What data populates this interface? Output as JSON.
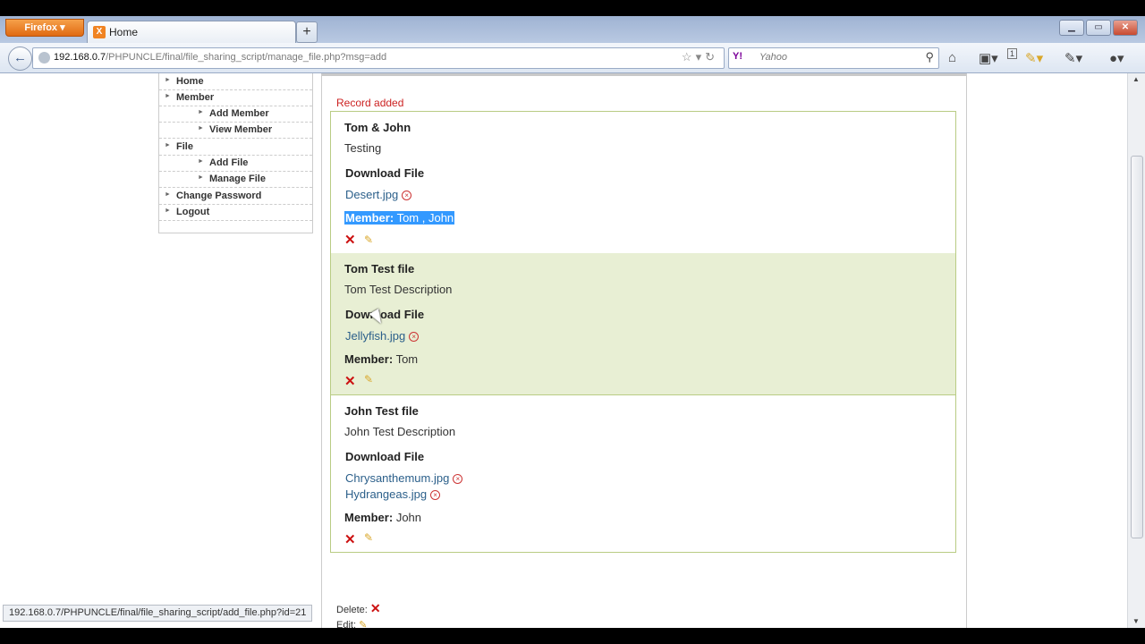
{
  "browser": {
    "app_button": "Firefox",
    "tab_title": "Home",
    "new_tab": "+",
    "url_host": "192.168.0.7",
    "url_path": "/PHPUNCLE/final/file_sharing_script/manage_file.php?msg=add",
    "search_engine": "Y!",
    "search_placeholder": "Yahoo",
    "status_url": "192.168.0.7/PHPUNCLE/final/file_sharing_script/add_file.php?id=21",
    "badge_count": "1"
  },
  "sidebar": {
    "items": [
      {
        "label": "Home"
      },
      {
        "label": "Member"
      },
      {
        "label": "Add Member"
      },
      {
        "label": "View Member"
      },
      {
        "label": "File"
      },
      {
        "label": "Add File"
      },
      {
        "label": "Manage File"
      },
      {
        "label": "Change Password"
      },
      {
        "label": "Logout"
      }
    ]
  },
  "main": {
    "message": "Record added",
    "download_label": "Download File",
    "member_label": "Member:",
    "records": [
      {
        "title": "Tom & John",
        "description": "Testing",
        "files": [
          "Desert.jpg"
        ],
        "members": "Tom , John"
      },
      {
        "title": "Tom Test file",
        "description": "Tom Test Description",
        "files": [
          "Jellyfish.jpg"
        ],
        "members": "Tom"
      },
      {
        "title": "John Test file",
        "description": "John Test Description",
        "files": [
          "Chrysanthemum.jpg",
          "Hydrangeas.jpg"
        ],
        "members": "John"
      }
    ],
    "legend": {
      "delete": "Delete:",
      "edit": "Edit:"
    }
  },
  "colors": {
    "accent_green": "#b9cc84",
    "alt_row": "#e8efd4",
    "link": "#2b5f8a",
    "message": "#cc2222"
  }
}
